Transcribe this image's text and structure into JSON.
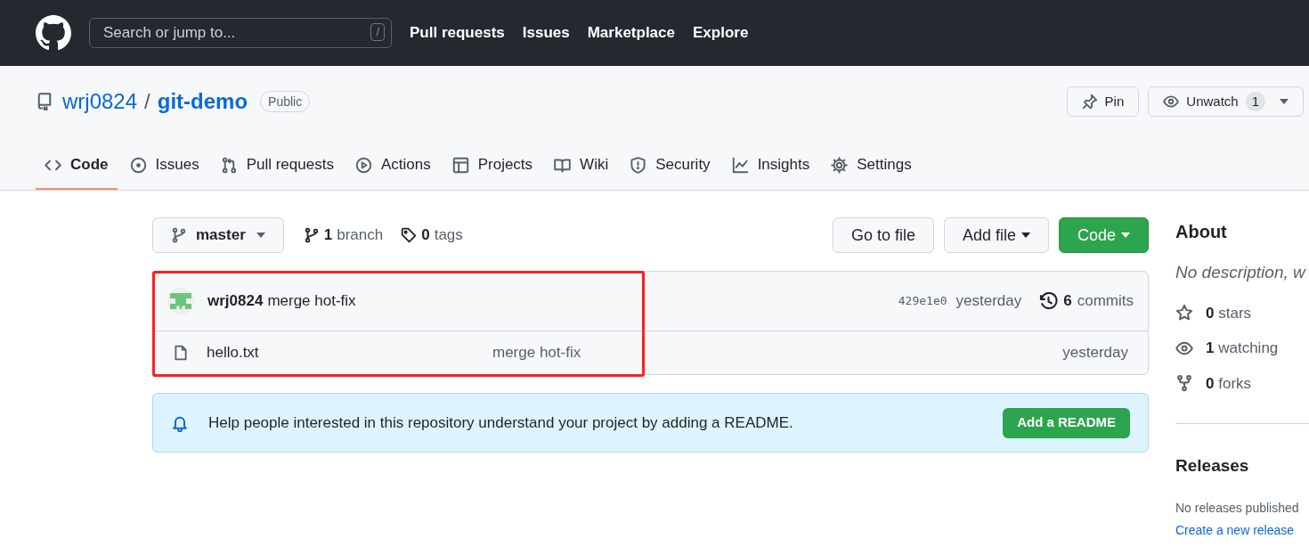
{
  "header": {
    "search": {
      "placeholder": "Search or jump to...",
      "shortcut": "/"
    },
    "nav": [
      "Pull requests",
      "Issues",
      "Marketplace",
      "Explore"
    ]
  },
  "repo": {
    "owner": "wrj0824",
    "separator": "/",
    "name": "git-demo",
    "visibility": "Public",
    "actions": [
      {
        "kind": "pin",
        "label": "Pin"
      },
      {
        "kind": "watch",
        "label": "Unwatch",
        "count": "1"
      }
    ]
  },
  "tabs": [
    {
      "label": "Code",
      "selected": true
    },
    {
      "label": "Issues",
      "selected": false
    },
    {
      "label": "Pull requests",
      "selected": false
    },
    {
      "label": "Actions",
      "selected": false
    },
    {
      "label": "Projects",
      "selected": false
    },
    {
      "label": "Wiki",
      "selected": false
    },
    {
      "label": "Security",
      "selected": false
    },
    {
      "label": "Insights",
      "selected": false
    },
    {
      "label": "Settings",
      "selected": false
    }
  ],
  "toolbar": {
    "branch": "master",
    "branches": {
      "count": "1",
      "label": "branch"
    },
    "tags": {
      "count": "0",
      "label": "tags"
    },
    "buttons": [
      {
        "label": "Go to file",
        "kind": "plain",
        "dropdown": false
      },
      {
        "label": "Add file",
        "kind": "plain",
        "dropdown": true
      },
      {
        "label": "Code",
        "kind": "primary",
        "dropdown": true
      }
    ]
  },
  "commit": {
    "author": "wrj0824",
    "message": "merge hot-fix",
    "hash": "429e1e0",
    "time": "yesterday",
    "commits": {
      "count": "6",
      "label": "commits"
    }
  },
  "files": [
    {
      "name": "hello.txt",
      "message": "merge hot-fix",
      "time": "yesterday"
    }
  ],
  "readme_banner": {
    "text": "Help people interested in this repository understand your project by adding a README.",
    "button": "Add a README"
  },
  "sidebar": {
    "about_title": "About",
    "description": "No description, w",
    "stats": [
      {
        "count": "0",
        "label": "stars"
      },
      {
        "count": "1",
        "label": "watching"
      },
      {
        "count": "0",
        "label": "forks"
      }
    ],
    "releases_title": "Releases",
    "releases_text": "No releases published",
    "releases_link": "Create a new release"
  }
}
